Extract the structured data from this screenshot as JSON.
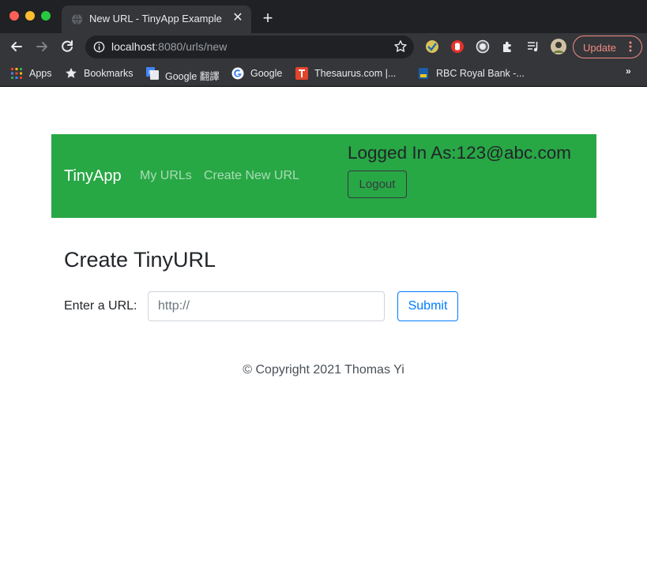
{
  "browser": {
    "tab_title": "New URL - TinyApp Example",
    "url_host": "localhost",
    "url_path": ":8080/urls/new",
    "update_label": "Update",
    "bookmarks": [
      {
        "label": "Apps",
        "icon": "apps-grid-icon"
      },
      {
        "label": "Bookmarks",
        "icon": "star-icon"
      },
      {
        "label": "Google 翻譯",
        "icon": "google-translate-icon"
      },
      {
        "label": "Google",
        "icon": "google-icon"
      },
      {
        "label": "Thesaurus.com |...",
        "icon": "thesaurus-icon"
      },
      {
        "label": "RBC Royal Bank -...",
        "icon": "rbc-icon"
      }
    ],
    "more_label": "»"
  },
  "navbar": {
    "brand": "TinyApp",
    "links": [
      "My URLs",
      "Create New URL"
    ],
    "logged_in": "Logged In As:123@abc.com",
    "logout_label": "Logout",
    "color": "#28a745"
  },
  "main": {
    "heading": "Create TinyURL",
    "form_label": "Enter a URL:",
    "input_placeholder": "http://",
    "input_value": "",
    "submit_label": "Submit"
  },
  "footer": {
    "text": "© Copyright 2021 Thomas Yi"
  },
  "colors": {
    "accent": "#007bff",
    "navbar_bg": "#28a745",
    "update_accent": "#f28b82"
  }
}
